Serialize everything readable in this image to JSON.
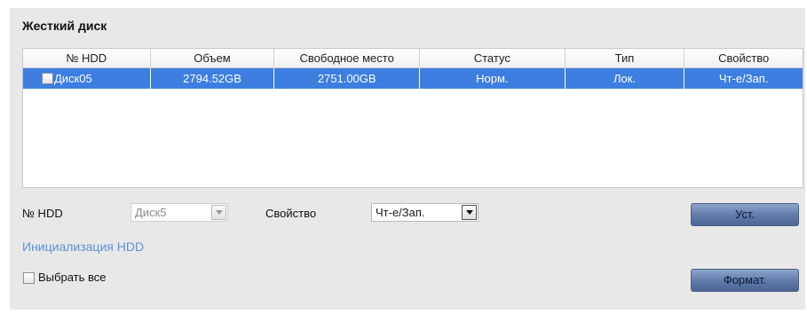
{
  "section": {
    "title": "Жесткий диск"
  },
  "table": {
    "columns": [
      "№ HDD",
      "Объем",
      "Свободное место",
      "Статус",
      "Тип",
      "Свойство"
    ],
    "rows": [
      {
        "hdd": "Диск05",
        "capacity": "2794.52GB",
        "free": "2751.00GB",
        "status": "Норм.",
        "type": "Лок.",
        "property": "Чт-е/Зап."
      }
    ]
  },
  "form": {
    "hdd_label": "№ HDD",
    "hdd_value": "Диск5",
    "property_label": "Свойство",
    "property_value": "Чт-е/Зап.",
    "set_button": "Уст."
  },
  "init_link": "Инициализация HDD",
  "select_all_label": "Выбрать все",
  "format_button": "Формат.",
  "colors": {
    "selected_row": "#3d7ee0",
    "link": "#5b93d6",
    "panel": "#e8e8e8"
  }
}
